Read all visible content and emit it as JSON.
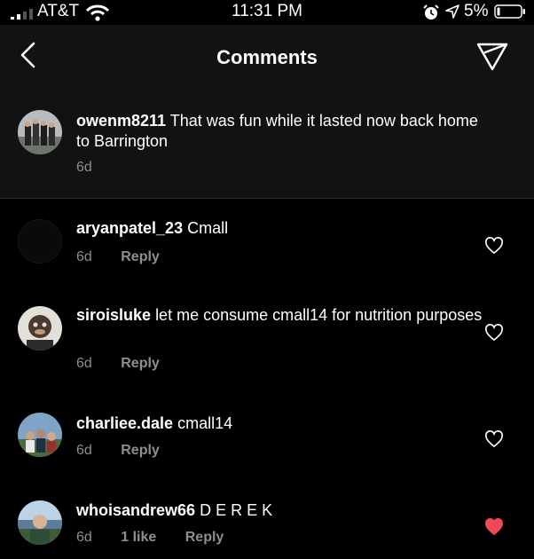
{
  "status_bar": {
    "carrier": "AT&T",
    "time": "11:31 PM",
    "battery": "5%",
    "icons": [
      "signal-icon",
      "wifi-icon",
      "alarm-icon",
      "location-arrow-icon",
      "battery-icon"
    ]
  },
  "header": {
    "title": "Comments",
    "back_icon": "chevron-left-icon",
    "send_icon": "paper-plane-icon"
  },
  "caption": {
    "username": "owenm8211",
    "text": "That was fun while it lasted now back home to Barrington",
    "age": "6d"
  },
  "comments": [
    {
      "username": "aryanpatel_23",
      "text": "Cmall",
      "age": "6d",
      "likes": "",
      "reply": "Reply",
      "liked": false
    },
    {
      "username": "siroisluke",
      "text": "let me consume cmall14 for nutrition purposes",
      "age": "6d",
      "likes": "",
      "reply": "Reply",
      "liked": false
    },
    {
      "username": "charliee.dale",
      "text": "cmall14",
      "age": "6d",
      "likes": "",
      "reply": "Reply",
      "liked": false
    },
    {
      "username": "whoisandrew66",
      "text": "D E R E K",
      "age": "6d",
      "likes": "1 like",
      "reply": "Reply",
      "liked": true
    }
  ],
  "colors": {
    "background": "#000000",
    "header_bg": "#121212",
    "secondary_text": "#8e8e8e",
    "like_red": "#ed4956"
  }
}
